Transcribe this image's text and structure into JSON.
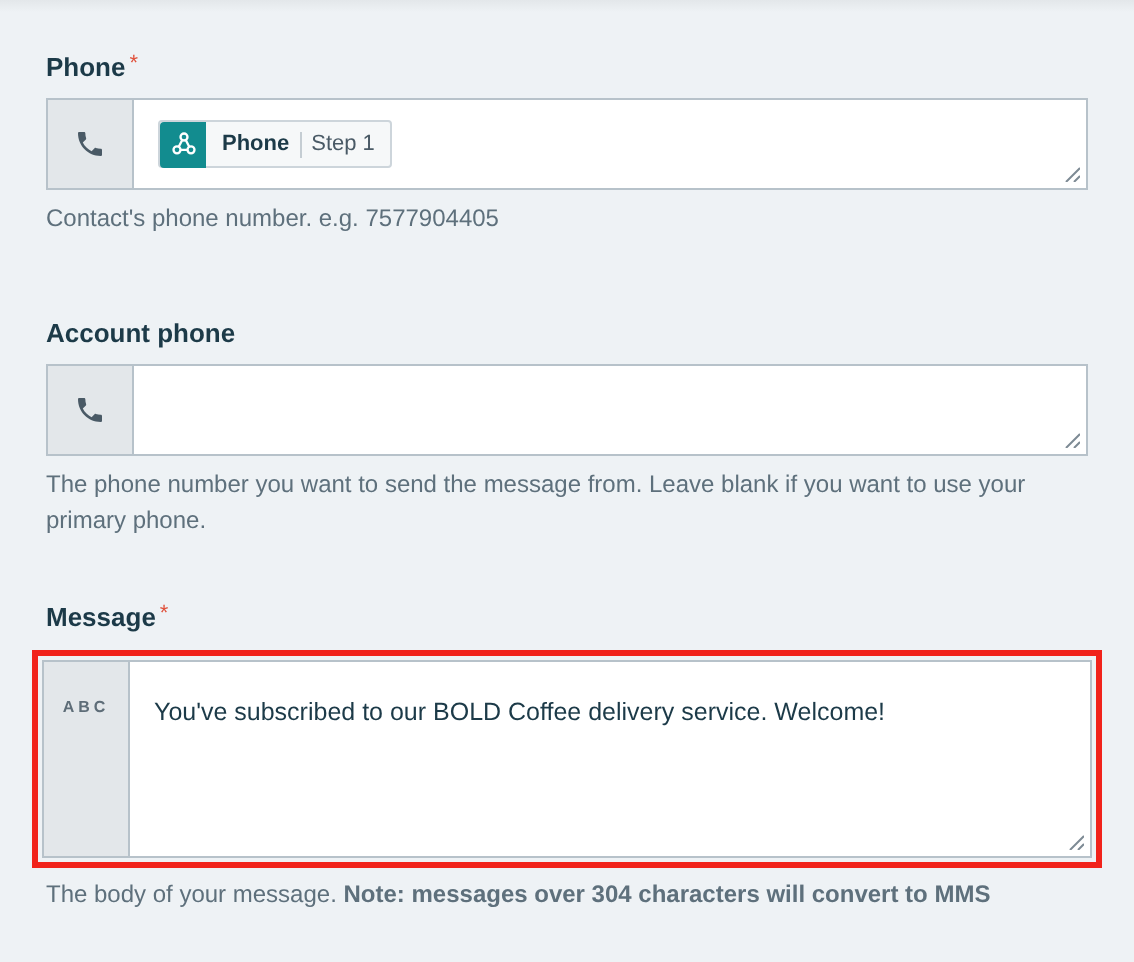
{
  "fields": [
    {
      "label": "Phone",
      "required": true,
      "kind": "phone",
      "highlighted": false,
      "token": {
        "label": "Phone",
        "step": "Step 1"
      },
      "help": "Contact's phone number. e.g. 7577904405"
    },
    {
      "label": "Account phone",
      "required": false,
      "kind": "phone",
      "highlighted": false,
      "help": "The phone number you want to send the message from. Leave blank if you want to use your primary phone."
    },
    {
      "label": "Message",
      "required": true,
      "kind": "text",
      "type_label": "ABC",
      "highlighted": true,
      "value": "You've subscribed to our BOLD Coffee delivery service. Welcome!",
      "help": "The body of your message. **Note: messages over 304 characters will convert to MMS**"
    }
  ],
  "required_mark": "*"
}
